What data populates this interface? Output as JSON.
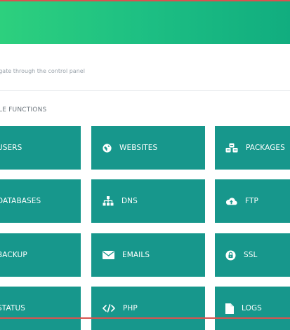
{
  "header": {
    "subtitle": "igate through the control panel"
  },
  "section": {
    "title": "LE FUNCTIONS"
  },
  "tiles": [
    {
      "label": "USERS"
    },
    {
      "label": "WEBSITES",
      "icon": "globe-icon"
    },
    {
      "label": "PACKAGES",
      "icon": "cubes-icon"
    },
    {
      "label": "DATABASES"
    },
    {
      "label": "DNS",
      "icon": "sitemap-icon"
    },
    {
      "label": "FTP",
      "icon": "cloud-upload-icon"
    },
    {
      "label": "BACKUP"
    },
    {
      "label": "EMAILS",
      "icon": "envelope-icon"
    },
    {
      "label": "SSL",
      "icon": "lock-icon"
    },
    {
      "label": "STATUS"
    },
    {
      "label": "PHP",
      "icon": "code-icon"
    },
    {
      "label": "LOGS",
      "icon": "file-icon"
    }
  ],
  "colors": {
    "banner_start": "#2dd07e",
    "banner_end": "#11ad7f",
    "tile": "#17978c"
  }
}
